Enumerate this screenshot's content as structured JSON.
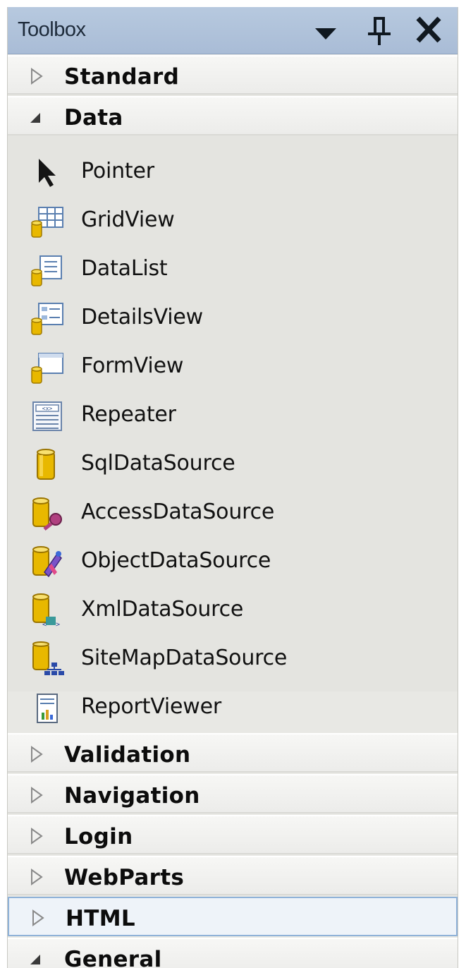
{
  "panel": {
    "title": "Toolbox",
    "buttons": [
      {
        "name": "dropdown-icon"
      },
      {
        "name": "pin-icon"
      },
      {
        "name": "close-icon"
      }
    ]
  },
  "categories_top": [
    {
      "label": "Standard",
      "expanded": false
    },
    {
      "label": "Data",
      "expanded": true
    }
  ],
  "data_items": [
    {
      "label": "Pointer",
      "icon": "pointer-icon"
    },
    {
      "label": "GridView",
      "icon": "gridview-icon"
    },
    {
      "label": "DataList",
      "icon": "datalist-icon"
    },
    {
      "label": "DetailsView",
      "icon": "detailsview-icon"
    },
    {
      "label": "FormView",
      "icon": "formview-icon"
    },
    {
      "label": "Repeater",
      "icon": "repeater-icon"
    },
    {
      "label": "SqlDataSource",
      "icon": "database-icon"
    },
    {
      "label": "AccessDataSource",
      "icon": "access-datasource-icon"
    },
    {
      "label": "ObjectDataSource",
      "icon": "object-datasource-icon"
    },
    {
      "label": "XmlDataSource",
      "icon": "xml-datasource-icon"
    },
    {
      "label": "SiteMapDataSource",
      "icon": "sitemap-datasource-icon"
    },
    {
      "label": "ReportViewer",
      "icon": "report-viewer-icon"
    }
  ],
  "categories_bottom": [
    {
      "label": "Validation",
      "expanded": false
    },
    {
      "label": "Navigation",
      "expanded": false
    },
    {
      "label": "Login",
      "expanded": false
    },
    {
      "label": "WebParts",
      "expanded": false
    },
    {
      "label": "HTML",
      "expanded": false,
      "selected": true
    },
    {
      "label": "General",
      "expanded": true
    }
  ],
  "colors": {
    "titlebar": "#b0c3db",
    "panel_bg": "#e8e8e4",
    "selection_border": "#8fb2d8",
    "db_yellow": "#e8b800"
  }
}
